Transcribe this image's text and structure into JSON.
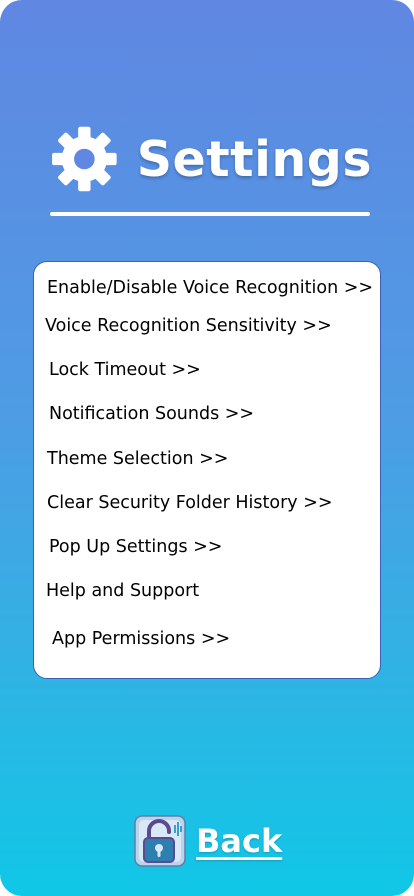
{
  "header": {
    "title": "Settings"
  },
  "menu": {
    "items": [
      "Enable/Disable Voice Recognition >>",
      "Voice Recognition Sensitivity >>",
      "Lock Timeout >>",
      "Notification Sounds >>",
      "Theme Selection >>",
      "Clear Security Folder History >>",
      "Pop Up Settings >>",
      "Help and Support",
      "App Permissions >>"
    ]
  },
  "footer": {
    "back_label": "Back"
  },
  "colors": {
    "gradient_top": "#6087e2",
    "gradient_bottom": "#10c7e6",
    "card_border": "#3d5fb8"
  },
  "icons": {
    "header_icon": "gear-icon",
    "footer_icon": "app-lock-icon"
  }
}
